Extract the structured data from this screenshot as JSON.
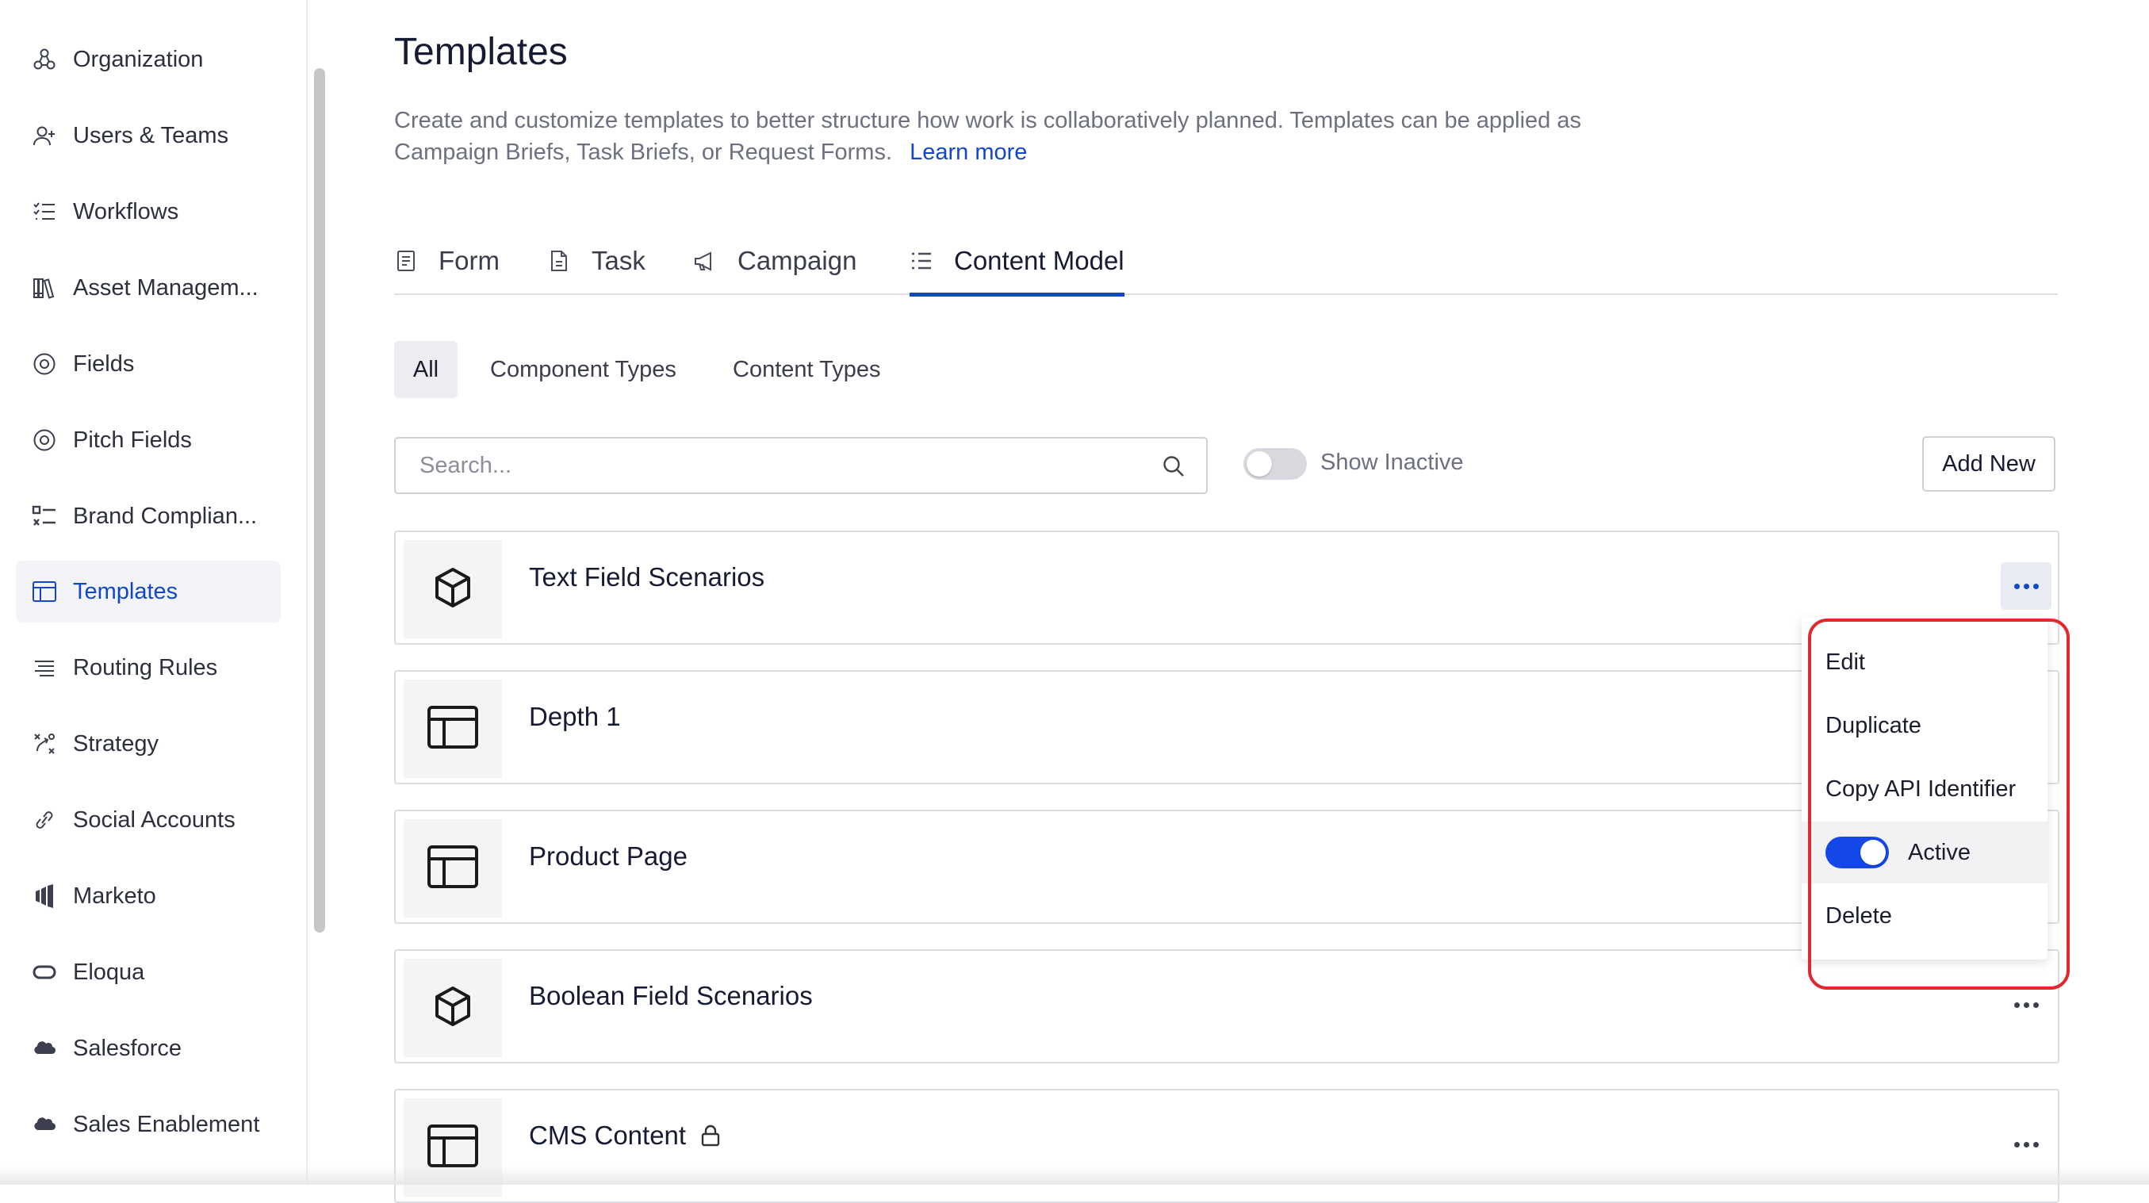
{
  "sidebar": {
    "items": [
      {
        "label": "Organization",
        "icon": "organization-icon"
      },
      {
        "label": "Users & Teams",
        "icon": "user-add-icon"
      },
      {
        "label": "Workflows",
        "icon": "checklist-icon"
      },
      {
        "label": "Asset Managem...",
        "icon": "library-icon"
      },
      {
        "label": "Fields",
        "icon": "target-icon"
      },
      {
        "label": "Pitch Fields",
        "icon": "target-icon"
      },
      {
        "label": "Brand Complian...",
        "icon": "brand-checklist-icon"
      },
      {
        "label": "Templates",
        "icon": "template-icon",
        "active": true
      },
      {
        "label": "Routing Rules",
        "icon": "routing-icon"
      },
      {
        "label": "Strategy",
        "icon": "strategy-icon"
      },
      {
        "label": "Social Accounts",
        "icon": "link-icon"
      },
      {
        "label": "Marketo",
        "icon": "marketo-icon"
      },
      {
        "label": "Eloqua",
        "icon": "eloqua-icon"
      },
      {
        "label": "Salesforce",
        "icon": "cloud-icon"
      },
      {
        "label": "Sales Enablement",
        "icon": "cloud-icon"
      }
    ]
  },
  "header": {
    "title": "Templates",
    "description": "Create and customize templates to better structure how work is collaboratively planned. Templates can be applied as Campaign Briefs, Task Briefs, or Request Forms.",
    "learn_more": "Learn more"
  },
  "tabs": [
    {
      "label": "Form",
      "icon": "form-icon"
    },
    {
      "label": "Task",
      "icon": "document-icon"
    },
    {
      "label": "Campaign",
      "icon": "megaphone-icon"
    },
    {
      "label": "Content Model",
      "icon": "list-icon",
      "active": true
    }
  ],
  "filters": {
    "chips": [
      "All",
      "Component Types",
      "Content Types"
    ],
    "active": "All"
  },
  "toolbar": {
    "search_placeholder": "Search...",
    "show_inactive_label": "Show Inactive",
    "show_inactive_on": false,
    "add_new_label": "Add New"
  },
  "templates": [
    {
      "name": "Text Field Scenarios",
      "icon": "cube-icon"
    },
    {
      "name": "Depth 1",
      "icon": "layout-icon"
    },
    {
      "name": "Product Page",
      "icon": "layout-icon"
    },
    {
      "name": "Boolean Field Scenarios",
      "icon": "cube-icon"
    },
    {
      "name": "CMS Content",
      "icon": "layout-icon",
      "locked": true
    }
  ],
  "context_menu": {
    "items": [
      "Edit",
      "Duplicate",
      "Copy API Identifier",
      "Active",
      "Delete"
    ],
    "active_toggle_on": true
  },
  "colors": {
    "accent": "#1347c8",
    "toggle_on": "#1347e8",
    "highlight": "#e0282e"
  }
}
